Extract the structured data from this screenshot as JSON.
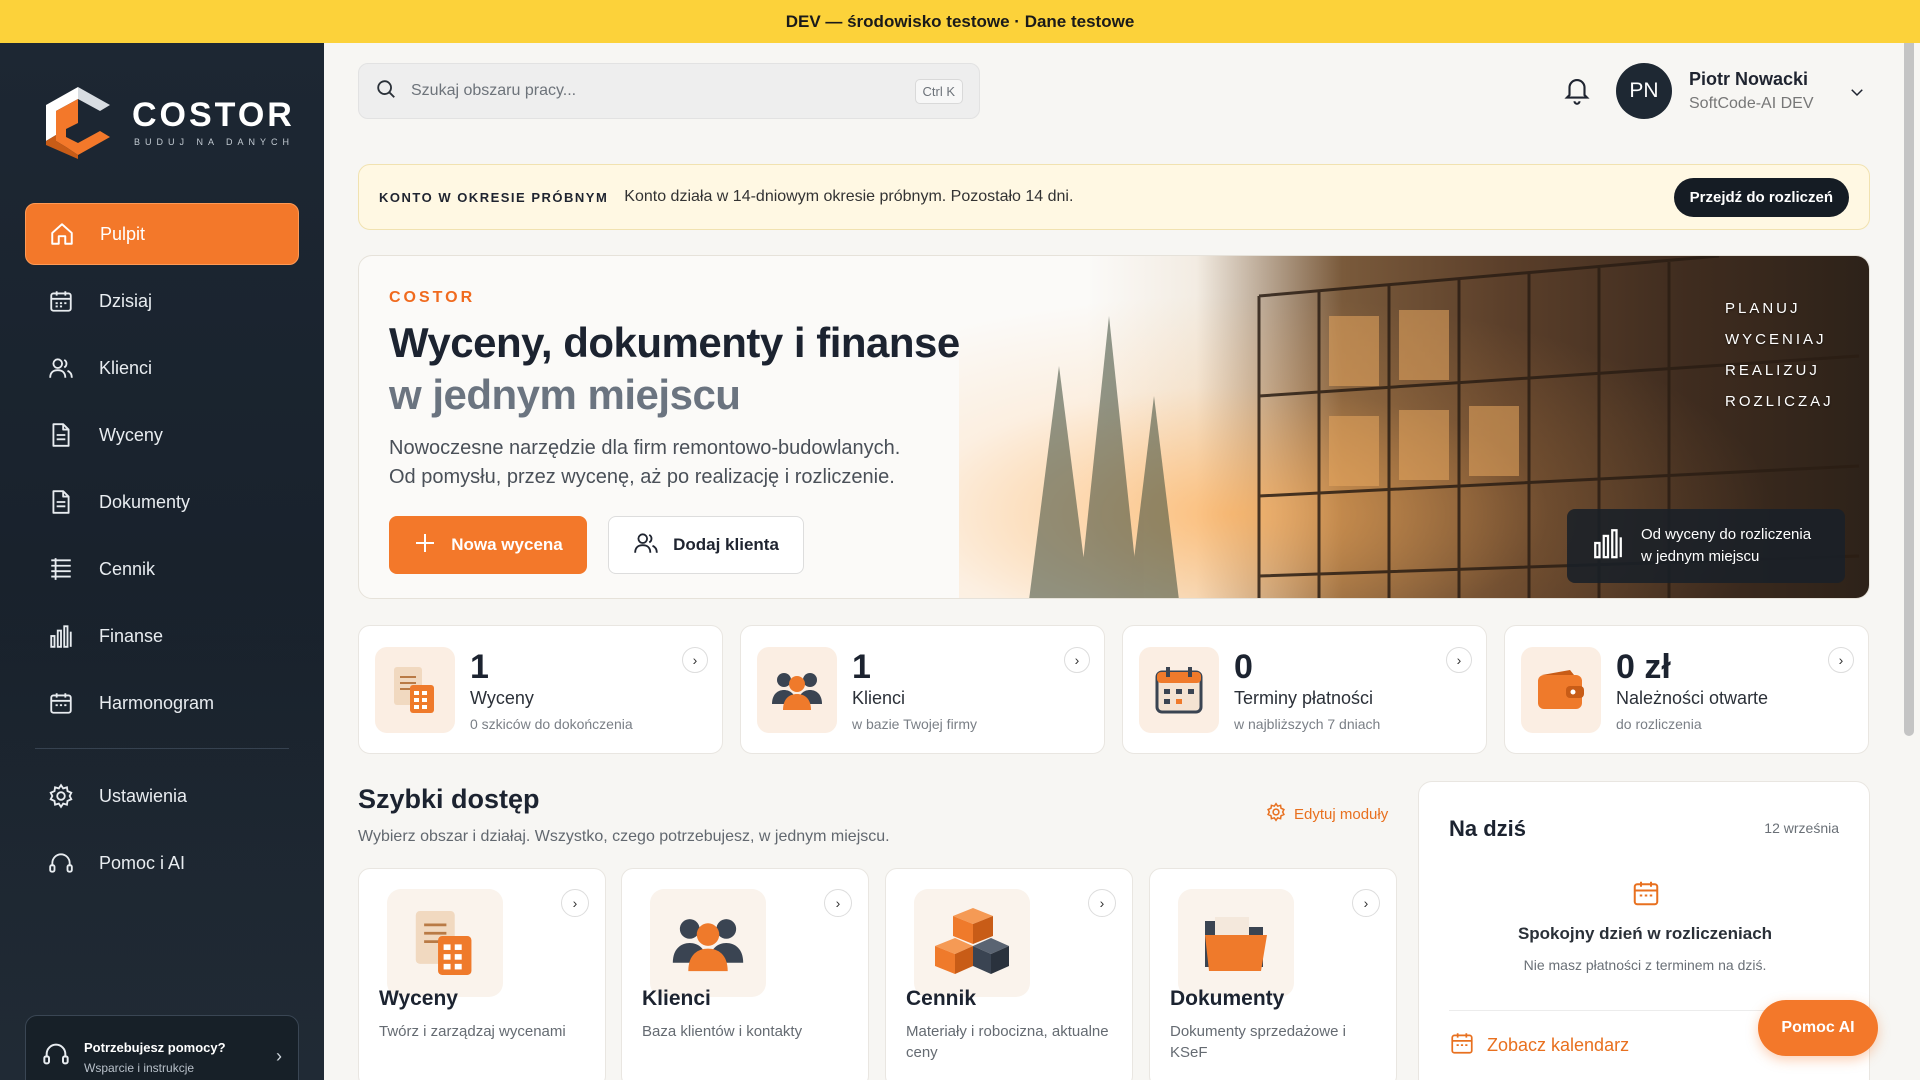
{
  "banner": {
    "text": "DEV — środowisko testowe · Dane testowe",
    "color": "#fcd23a"
  },
  "brand": {
    "name": "COSTOR",
    "tagline": "BUDUJ NA DANYCH",
    "accent": "#f3782a",
    "dark": "#1d2733"
  },
  "sidebar": {
    "items": [
      {
        "label": "Pulpit",
        "icon": "home-icon",
        "active": true
      },
      {
        "label": "Dzisiaj",
        "icon": "calendar-icon"
      },
      {
        "label": "Klienci",
        "icon": "users-icon"
      },
      {
        "label": "Wyceny",
        "icon": "document-icon"
      },
      {
        "label": "Dokumenty",
        "icon": "document-icon"
      },
      {
        "label": "Cennik",
        "icon": "list-icon"
      },
      {
        "label": "Finanse",
        "icon": "bar-chart-icon"
      },
      {
        "label": "Harmonogram",
        "icon": "calendar-icon"
      }
    ],
    "secondary": [
      {
        "label": "Ustawienia",
        "icon": "gear-icon"
      },
      {
        "label": "Pomoc i AI",
        "icon": "headset-icon"
      }
    ],
    "help": {
      "title": "Potrzebujesz pomocy?",
      "subtitle": "Wsparcie i instrukcje"
    }
  },
  "topbar": {
    "search_placeholder": "Szukaj obszaru pracy...",
    "shortcut": "Ctrl K",
    "user": {
      "initials": "PN",
      "name": "Piotr Nowacki",
      "org": "SoftCode-AI DEV"
    }
  },
  "trial": {
    "tag": "KONTO W OKRESIE PRÓBNYM",
    "text": "Konto działa w 14-dniowym okresie próbnym. Pozostało 14 dni.",
    "button": "Przejdź do rozliczeń"
  },
  "hero": {
    "kicker": "COSTOR",
    "title_line1": "Wyceny, dokumenty i finanse",
    "title_line2": "w jednym miejscu",
    "desc_line1": "Nowoczesne narzędzie dla firm remontowo-budowlanych.",
    "desc_line2": "Od pomysłu, przez wycenę, aż po realizację i rozliczenie.",
    "primary_button": "Nowa wycena",
    "secondary_button": "Dodaj klienta",
    "words": [
      "PLANUJ",
      "WYCENIAJ",
      "REALIZUJ",
      "ROZLICZAJ"
    ],
    "badge_line1": "Od wyceny do rozliczenia",
    "badge_line2": "w jednym miejscu"
  },
  "stats": [
    {
      "value": "1",
      "label": "Wyceny",
      "sub": "0 szkiców do dokończenia",
      "icon": "calculator-icon"
    },
    {
      "value": "1",
      "label": "Klienci",
      "sub": "w bazie Twojej firmy",
      "icon": "people-icon"
    },
    {
      "value": "0",
      "label": "Terminy płatności",
      "sub": "w najbliższych 7 dniach",
      "icon": "calendar-icon"
    },
    {
      "value": "0 zł",
      "label": "Należności otwarte",
      "sub": "do rozliczenia",
      "icon": "wallet-icon"
    }
  ],
  "quick_access": {
    "title": "Szybki dostęp",
    "subtitle": "Wybierz obszar i działaj. Wszystko, czego potrzebujesz, w jednym miejscu.",
    "edit_label": "Edytuj moduły",
    "tiles": [
      {
        "title": "Wyceny",
        "sub": "Twórz i zarządzaj wycenami",
        "icon": "calculator-icon"
      },
      {
        "title": "Klienci",
        "sub": "Baza klientów i kontakty",
        "icon": "people-icon"
      },
      {
        "title": "Cennik",
        "sub": "Materiały i robocizna, aktualne ceny",
        "icon": "boxes-icon"
      },
      {
        "title": "Dokumenty",
        "sub": "Dokumenty sprzedażowe i KSeF",
        "icon": "folder-icon"
      }
    ]
  },
  "today": {
    "title": "Na dziś",
    "date": "12 września",
    "message": "Spokojny dzień w rozliczeniach",
    "sub": "Nie masz płatności z terminem na dziś.",
    "link": "Zobacz kalendarz"
  },
  "fab": {
    "label": "Pomoc AI"
  }
}
